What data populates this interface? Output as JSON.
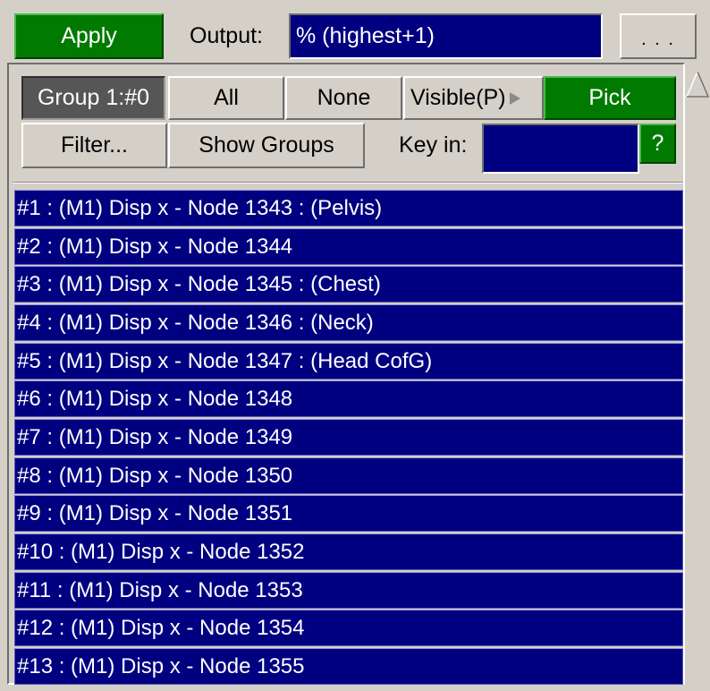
{
  "toolbar": {
    "apply_label": "Apply",
    "output_label": "Output:",
    "output_value": "% (highest+1)",
    "more_label": ". . ."
  },
  "group_bar": {
    "group_label": "Group 1:#0",
    "all_label": "All",
    "none_label": "None",
    "visible_label": "Visible(P)",
    "pick_label": "Pick",
    "filter_label": "Filter...",
    "show_groups_label": "Show Groups",
    "key_in_label": "Key in:",
    "key_in_value": "",
    "help_label": "?"
  },
  "list": {
    "items": [
      "#1 : (M1) Disp x - Node 1343 : (Pelvis)",
      "#2 : (M1) Disp x - Node 1344",
      "#3 : (M1) Disp x - Node 1345 : (Chest)",
      "#4 : (M1) Disp x - Node 1346 : (Neck)",
      "#5 : (M1) Disp x - Node 1347 : (Head CofG)",
      "#6 : (M1) Disp x - Node 1348",
      "#7 : (M1) Disp x - Node 1349",
      "#8 : (M1) Disp x - Node 1350",
      "#9 : (M1) Disp x - Node 1351",
      "#10 : (M1) Disp x - Node 1352",
      "#11 : (M1) Disp x - Node 1353",
      "#12 : (M1) Disp x - Node 1354",
      "#13 : (M1) Disp x - Node 1355"
    ]
  },
  "colors": {
    "apply_green": "#007a00",
    "list_navy": "#000080",
    "panel_gray": "#d4d0c8"
  },
  "icons": {
    "visible_arrow": "play-triangle-icon",
    "scroll_up": "scroll-up-arrow-icon"
  }
}
